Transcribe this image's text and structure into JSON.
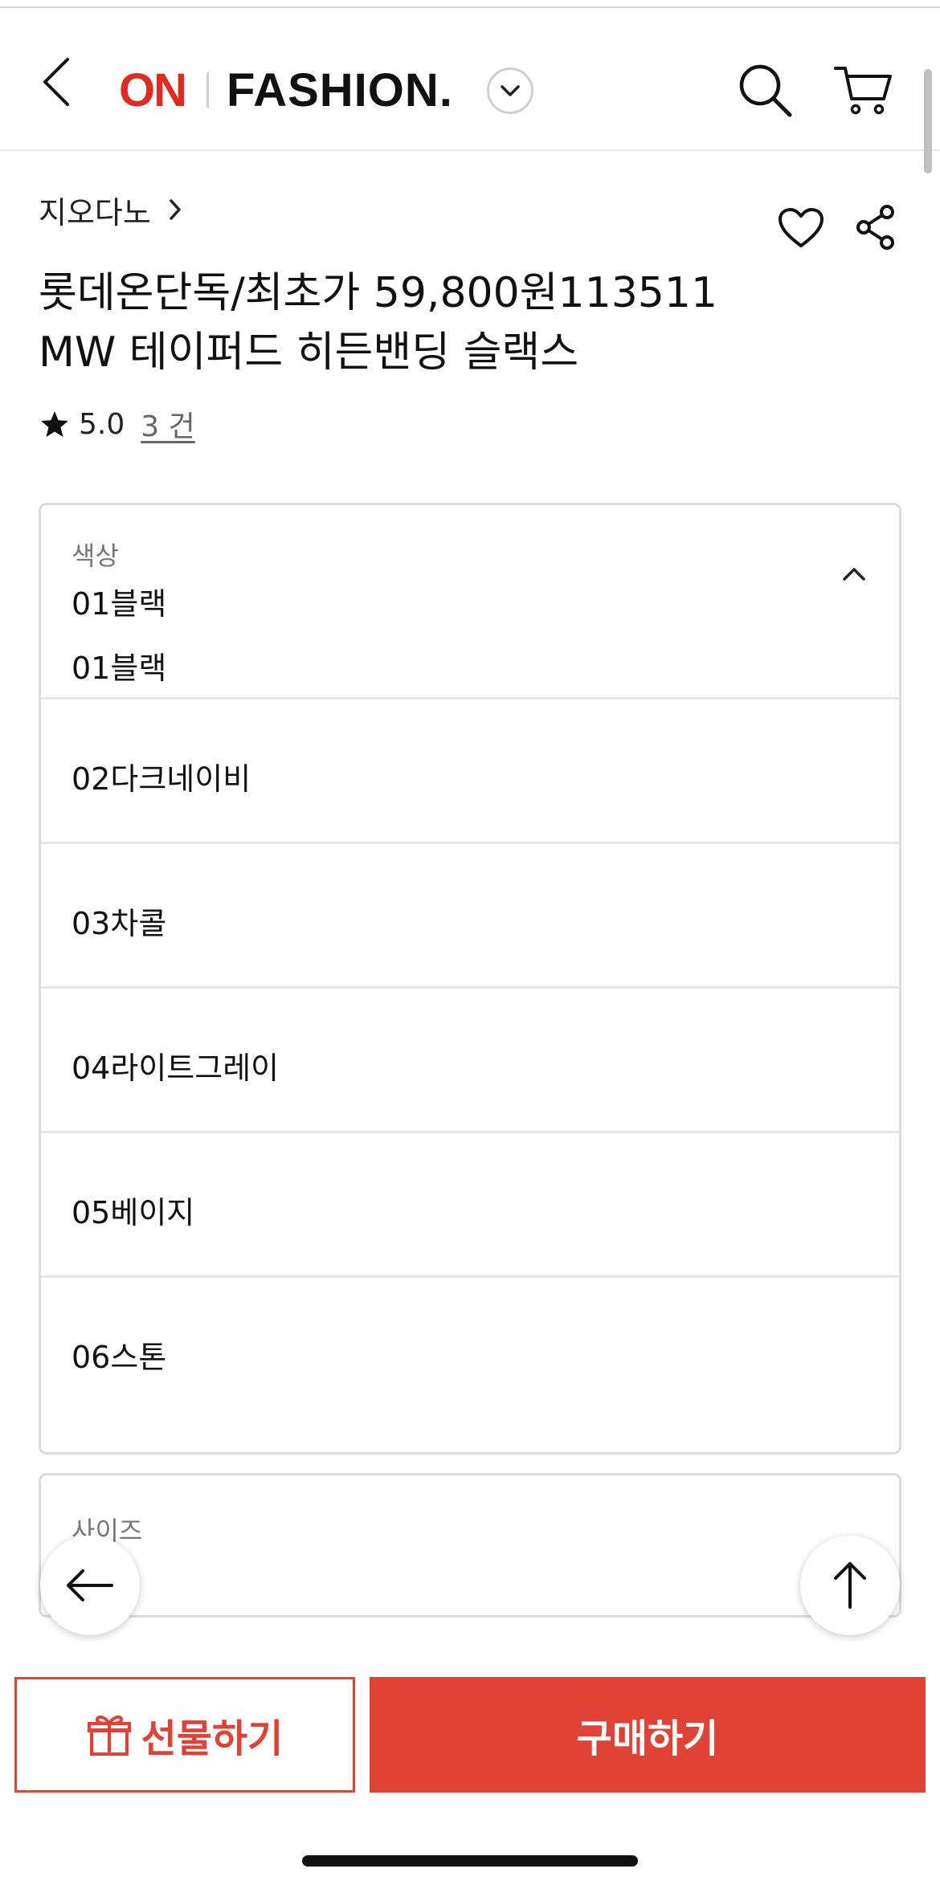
{
  "header": {
    "logo_on": "ON",
    "logo_fashion": "FASHION."
  },
  "product": {
    "brand": "지오다노",
    "title_line1": "롯데온단독/최초가 59,800원113511",
    "title_line2": "MW 테이퍼드 히든밴딩 슬랙스",
    "rating": "5.0",
    "review_count": "3 건"
  },
  "color_select": {
    "label": "색상",
    "selected": "01블랙",
    "options": [
      "01블랙",
      "02다크네이비",
      "03차콜",
      "04라이트그레이",
      "05베이지",
      "06스톤"
    ]
  },
  "size_select": {
    "label": "사이즈"
  },
  "actions": {
    "gift": "선물하기",
    "buy": "구매하기"
  },
  "colors": {
    "brand_red": "#e02b20",
    "button_red": "#e04335"
  }
}
